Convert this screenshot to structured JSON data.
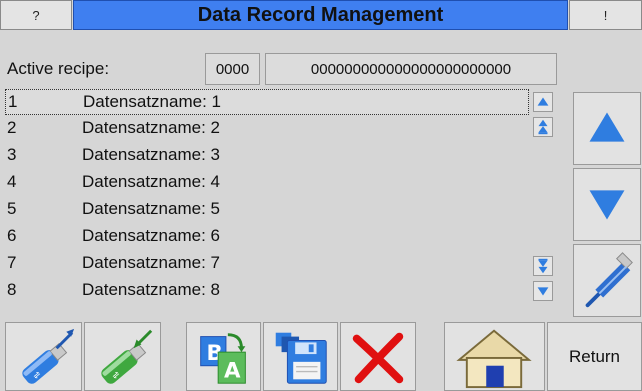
{
  "titlebar": {
    "help_label": "?",
    "title": "Data Record Management",
    "info_label": "!"
  },
  "active_recipe": {
    "label": "Active recipe:",
    "number": "0000",
    "name": "000000000000000000000000"
  },
  "records": [
    {
      "num": "1",
      "name": "Datensatzname: 1"
    },
    {
      "num": "2",
      "name": "Datensatzname: 2"
    },
    {
      "num": "3",
      "name": "Datensatzname: 3"
    },
    {
      "num": "4",
      "name": "Datensatzname: 4"
    },
    {
      "num": "5",
      "name": "Datensatzname: 5"
    },
    {
      "num": "6",
      "name": "Datensatzname: 6"
    },
    {
      "num": "7",
      "name": "Datensatzname: 7"
    },
    {
      "num": "8",
      "name": "Datensatzname: 8"
    }
  ],
  "selected_record": "1",
  "scroll_icons": [
    "scroll-up-icon",
    "page-up-icon",
    "page-down-icon",
    "scroll-down-icon"
  ],
  "side_icons": [
    "arrow-up-icon",
    "arrow-down-icon",
    "edit-pen-icon"
  ],
  "bottom_icons": [
    "usb-export-icon",
    "usb-import-icon",
    "rename-icon",
    "save-icon",
    "delete-icon",
    "home-icon"
  ],
  "bottom": {
    "return_label": "Return"
  },
  "colors": {
    "title_bar": "#3f7ff0",
    "arrow_blue": "#2f7de0",
    "delete_red": "#e01010",
    "background": "#d6d6d6"
  }
}
